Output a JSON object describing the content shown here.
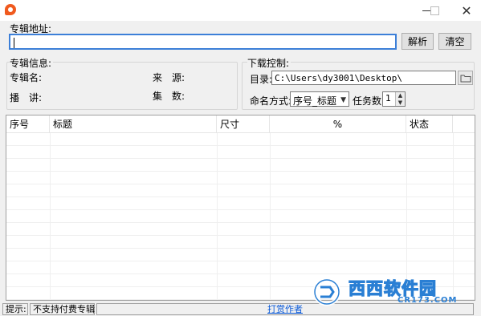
{
  "window": {
    "title": ""
  },
  "album_address": {
    "label": "专辑地址:",
    "value": "",
    "parse_button": "解析",
    "clear_button": "清空"
  },
  "album_info": {
    "title": "专辑信息:",
    "album_name_label": "专辑名:",
    "source_label": "来　源:",
    "speaker_label": "播　讲:",
    "episodes_label": "集　数:"
  },
  "download_control": {
    "title": "下载控制:",
    "dir_label": "目录:",
    "dir_value": "C:\\Users\\dy3001\\Desktop\\",
    "naming_label": "命名方式:",
    "naming_value": "序号_标题",
    "tasks_label": "任务数:",
    "tasks_value": "1"
  },
  "table": {
    "columns": [
      "序号",
      "标题",
      "尺寸",
      "%",
      "状态"
    ],
    "rows": []
  },
  "statusbar": {
    "hint_label": "提示:",
    "hint_text": "不支持付费专辑",
    "donate_link": "打赏作者"
  },
  "watermark": {
    "brand": "西西软件园",
    "domain": "CR173.COM"
  },
  "colors": {
    "accent": "#3c7fd8",
    "link": "#0b5ad8",
    "app_icon": "#f05a1e"
  }
}
